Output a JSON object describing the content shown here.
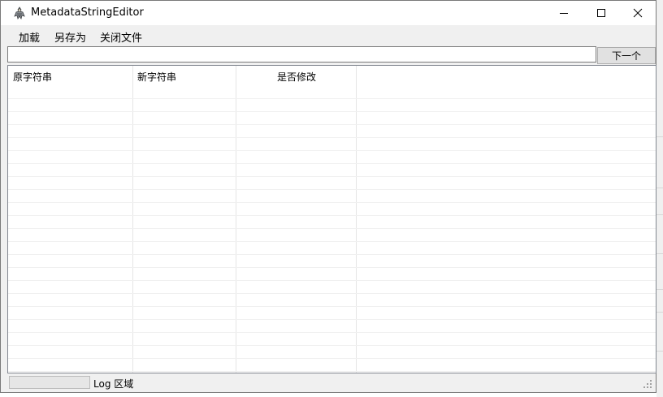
{
  "window": {
    "title": "MetadataStringEditor",
    "icon": "app-icon"
  },
  "menu": {
    "items": [
      {
        "label": "加载"
      },
      {
        "label": "另存为"
      },
      {
        "label": "关闭文件"
      }
    ]
  },
  "search": {
    "value": "",
    "next_label": "下一个"
  },
  "grid": {
    "columns": [
      {
        "label": "原字符串",
        "align": "left"
      },
      {
        "label": "新字符串",
        "align": "left"
      },
      {
        "label": "是否修改",
        "align": "center"
      }
    ],
    "rows": []
  },
  "status": {
    "progress": 0,
    "text": "Log 区域"
  },
  "colors": {
    "progress_fill": "#06b025",
    "grid_border": "#828790",
    "button_face": "#e1e1e1"
  }
}
